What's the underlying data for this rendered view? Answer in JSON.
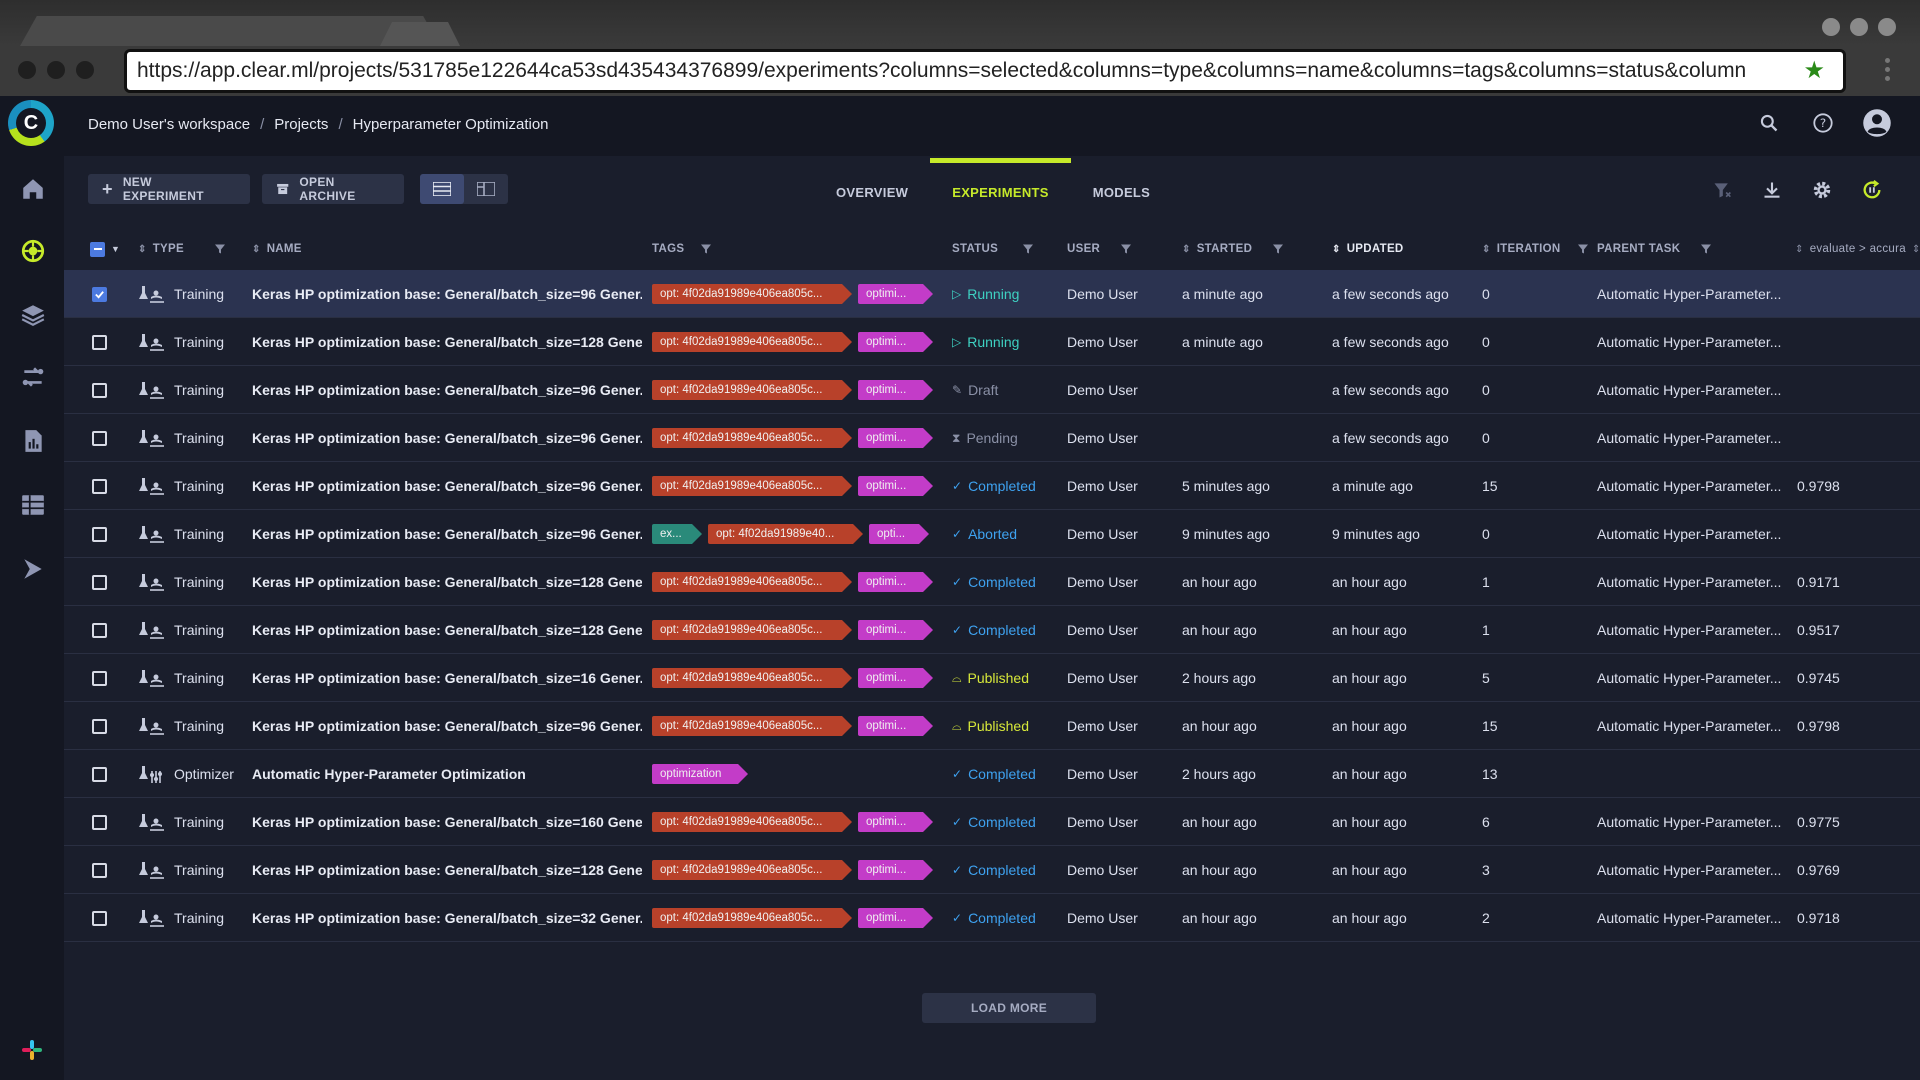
{
  "browser": {
    "url": "https://app.clear.ml/projects/531785e122644ca53sd435434376899/experiments?columns=selected&columns=type&columns=name&columns=tags&columns=status&column"
  },
  "breadcrumb": {
    "workspace": "Demo User's workspace",
    "projects": "Projects",
    "project": "Hyperparameter Optimization"
  },
  "toolbar": {
    "new_experiment": "NEW EXPERIMENT",
    "open_archive": "OPEN ARCHIVE"
  },
  "tabs": {
    "overview": "OVERVIEW",
    "experiments": "EXPERIMENTS",
    "models": "MODELS"
  },
  "columns": {
    "type": "TYPE",
    "name": "NAME",
    "tags": "TAGS",
    "status": "STATUS",
    "user": "USER",
    "started": "STARTED",
    "updated": "UPDATED",
    "iteration": "ITERATION",
    "parent_task": "PARENT TASK",
    "metric": "evaluate > accura"
  },
  "rows": [
    {
      "type": "Training",
      "name": "Keras HP optimization base: General/batch_size=96 Gener...",
      "tags": [
        {
          "kind": "opt",
          "text": "opt: 4f02da91989e406ea805c..."
        },
        {
          "kind": "optimi",
          "text": "optimi..."
        }
      ],
      "status": "Running",
      "status_kind": "running",
      "user": "Demo User",
      "started": "a minute ago",
      "updated": "a few seconds ago",
      "iteration": "0",
      "parent": "Automatic Hyper-Parameter...",
      "metric": "",
      "selected": true
    },
    {
      "type": "Training",
      "name": "Keras HP optimization base: General/batch_size=128 Gene...",
      "tags": [
        {
          "kind": "opt",
          "text": "opt: 4f02da91989e406ea805c..."
        },
        {
          "kind": "optimi",
          "text": "optimi..."
        }
      ],
      "status": "Running",
      "status_kind": "running",
      "user": "Demo User",
      "started": "a minute ago",
      "updated": "a few seconds ago",
      "iteration": "0",
      "parent": "Automatic Hyper-Parameter...",
      "metric": ""
    },
    {
      "type": "Training",
      "name": "Keras HP optimization base: General/batch_size=96 Gener...",
      "tags": [
        {
          "kind": "opt",
          "text": "opt: 4f02da91989e406ea805c..."
        },
        {
          "kind": "optimi",
          "text": "optimi..."
        }
      ],
      "status": "Draft",
      "status_kind": "draft",
      "user": "Demo User",
      "started": "",
      "updated": "a few seconds ago",
      "iteration": "0",
      "parent": "Automatic Hyper-Parameter...",
      "metric": ""
    },
    {
      "type": "Training",
      "name": "Keras HP optimization base: General/batch_size=96 Gener...",
      "tags": [
        {
          "kind": "opt",
          "text": "opt: 4f02da91989e406ea805c..."
        },
        {
          "kind": "optimi",
          "text": "optimi..."
        }
      ],
      "status": "Pending",
      "status_kind": "pending",
      "user": "Demo User",
      "started": "",
      "updated": "a few seconds ago",
      "iteration": "0",
      "parent": "Automatic Hyper-Parameter...",
      "metric": ""
    },
    {
      "type": "Training",
      "name": "Keras HP optimization base: General/batch_size=96 Gener...",
      "tags": [
        {
          "kind": "opt",
          "text": "opt: 4f02da91989e406ea805c..."
        },
        {
          "kind": "optimi",
          "text": "optimi..."
        }
      ],
      "status": "Completed",
      "status_kind": "completed",
      "user": "Demo User",
      "started": "5 minutes ago",
      "updated": "a minute ago",
      "iteration": "15",
      "parent": "Automatic Hyper-Parameter...",
      "metric": "0.9798"
    },
    {
      "type": "Training",
      "name": "Keras HP optimization base: General/batch_size=96 Gener...",
      "tags": [
        {
          "kind": "ex",
          "text": "ex..."
        },
        {
          "kind": "opt2",
          "text": "opt: 4f02da91989e40..."
        },
        {
          "kind": "opti",
          "text": "opti..."
        }
      ],
      "status": "Aborted",
      "status_kind": "aborted",
      "user": "Demo User",
      "started": "9 minutes ago",
      "updated": "9 minutes ago",
      "iteration": "0",
      "parent": "Automatic Hyper-Parameter...",
      "metric": ""
    },
    {
      "type": "Training",
      "name": "Keras HP optimization base: General/batch_size=128 Gene...",
      "tags": [
        {
          "kind": "opt",
          "text": "opt: 4f02da91989e406ea805c..."
        },
        {
          "kind": "optimi",
          "text": "optimi..."
        }
      ],
      "status": "Completed",
      "status_kind": "completed",
      "user": "Demo User",
      "started": "an hour ago",
      "updated": "an hour ago",
      "iteration": "1",
      "parent": "Automatic Hyper-Parameter...",
      "metric": "0.9171"
    },
    {
      "type": "Training",
      "name": "Keras HP optimization base: General/batch_size=128 Gene...",
      "tags": [
        {
          "kind": "opt",
          "text": "opt: 4f02da91989e406ea805c..."
        },
        {
          "kind": "optimi",
          "text": "optimi..."
        }
      ],
      "status": "Completed",
      "status_kind": "completed",
      "user": "Demo User",
      "started": "an hour ago",
      "updated": "an hour ago",
      "iteration": "1",
      "parent": "Automatic Hyper-Parameter...",
      "metric": "0.9517"
    },
    {
      "type": "Training",
      "name": "Keras HP optimization base: General/batch_size=16 Gener...",
      "tags": [
        {
          "kind": "opt",
          "text": "opt: 4f02da91989e406ea805c..."
        },
        {
          "kind": "optimi",
          "text": "optimi..."
        }
      ],
      "status": "Published",
      "status_kind": "published",
      "user": "Demo User",
      "started": "2 hours ago",
      "updated": "an hour ago",
      "iteration": "5",
      "parent": "Automatic Hyper-Parameter...",
      "metric": "0.9745"
    },
    {
      "type": "Training",
      "name": "Keras HP optimization base: General/batch_size=96 Gener...",
      "tags": [
        {
          "kind": "opt",
          "text": "opt: 4f02da91989e406ea805c..."
        },
        {
          "kind": "optimi",
          "text": "optimi..."
        }
      ],
      "status": "Published",
      "status_kind": "published",
      "user": "Demo User",
      "started": "an hour ago",
      "updated": "an hour ago",
      "iteration": "15",
      "parent": "Automatic Hyper-Parameter...",
      "metric": "0.9798"
    },
    {
      "type": "Optimizer",
      "name": "Automatic Hyper-Parameter Optimization",
      "tags": [
        {
          "kind": "optimization",
          "text": "optimization"
        }
      ],
      "status": "Completed",
      "status_kind": "completed",
      "user": "Demo User",
      "started": "2 hours ago",
      "updated": "an hour ago",
      "iteration": "13",
      "parent": "",
      "metric": ""
    },
    {
      "type": "Training",
      "name": "Keras HP optimization base: General/batch_size=160 Gene...",
      "tags": [
        {
          "kind": "opt",
          "text": "opt: 4f02da91989e406ea805c..."
        },
        {
          "kind": "optimi",
          "text": "optimi..."
        }
      ],
      "status": "Completed",
      "status_kind": "completed",
      "user": "Demo User",
      "started": "an hour ago",
      "updated": "an hour ago",
      "iteration": "6",
      "parent": "Automatic Hyper-Parameter...",
      "metric": "0.9775"
    },
    {
      "type": "Training",
      "name": "Keras HP optimization base: General/batch_size=128 Gene...",
      "tags": [
        {
          "kind": "opt",
          "text": "opt: 4f02da91989e406ea805c..."
        },
        {
          "kind": "optimi",
          "text": "optimi..."
        }
      ],
      "status": "Completed",
      "status_kind": "completed",
      "user": "Demo User",
      "started": "an hour ago",
      "updated": "an hour ago",
      "iteration": "3",
      "parent": "Automatic Hyper-Parameter...",
      "metric": "0.9769"
    },
    {
      "type": "Training",
      "name": "Keras HP optimization base: General/batch_size=32 Gener...",
      "tags": [
        {
          "kind": "opt",
          "text": "opt: 4f02da91989e406ea805c..."
        },
        {
          "kind": "optimi",
          "text": "optimi..."
        }
      ],
      "status": "Completed",
      "status_kind": "completed",
      "user": "Demo User",
      "started": "an hour ago",
      "updated": "an hour ago",
      "iteration": "2",
      "parent": "Automatic Hyper-Parameter...",
      "metric": "0.9718"
    }
  ],
  "load_more": "LOAD MORE",
  "icons": {
    "sidebar": [
      "home-icon",
      "brain-icon",
      "layers-icon",
      "pipelines-icon",
      "reports-icon",
      "datasets-icon",
      "deploy-icon"
    ],
    "accent_color": "#c6ea2a",
    "selected_row_color": "#2b3350"
  }
}
